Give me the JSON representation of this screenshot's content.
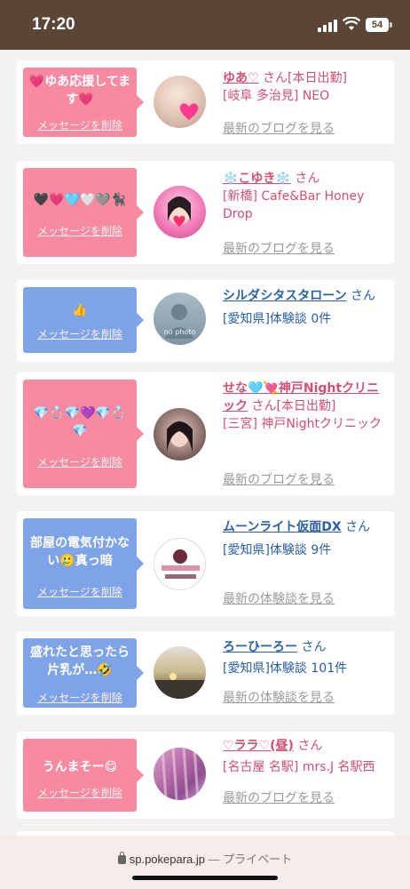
{
  "status_bar": {
    "time": "17:20",
    "battery": "54"
  },
  "cards": [
    {
      "type": "pink",
      "message": "💗ゆあ応援してます💗",
      "delete_label": "メッセージを削除",
      "name": "ゆあ♡",
      "honorific": "さん",
      "extra": "[本日出勤]",
      "detail": "[岐阜 多治見] NEO",
      "link": "最新のブログを見る"
    },
    {
      "type": "pink",
      "message": "🖤💗🩵🤍🩶🐈‍⬛",
      "delete_label": "メッセージを削除",
      "name": "❄️こゆき❄️",
      "honorific": "さん",
      "extra": "",
      "detail": "[新橋] Cafe&Bar Honey Drop",
      "link": "最新のブログを見る"
    },
    {
      "type": "blue",
      "message": "👍",
      "delete_label": "メッセージを削除",
      "name": "シルダシタスタローン",
      "honorific": "さん",
      "extra": "",
      "detail": "[愛知県]体験談 0件",
      "link": "",
      "avatar_text": "no photo"
    },
    {
      "type": "pink",
      "message": "💎💍💎💜💎💍💎",
      "delete_label": "メッセージを削除",
      "name": "せな🩵💘神戸Nightクリニック",
      "honorific": "さん",
      "extra": "[本日出勤]",
      "detail": "[三宮] 神戸Nightクリニック",
      "link": "最新のブログを見る"
    },
    {
      "type": "blue",
      "message": "部屋の電気付かない🥲真っ暗",
      "delete_label": "メッセージを削除",
      "name": "ムーンライト仮面DX",
      "honorific": "さん",
      "extra": "",
      "detail": "[愛知県]体験談 9件",
      "link": "最新の体験談を見る"
    },
    {
      "type": "blue",
      "message": "盛れたと思ったら片乳が…🤣",
      "delete_label": "メッセージを削除",
      "name": "ろーひーろー",
      "honorific": "さん",
      "extra": "",
      "detail": "[愛知県]体験談 101件",
      "link": "最新の体験談を見る"
    },
    {
      "type": "pink",
      "message": "うんまそー😋",
      "delete_label": "メッセージを削除",
      "name": "♡ララ♡(昼)",
      "honorific": "さん",
      "extra": "",
      "detail": "[名古屋 名駅] mrs.J 名駅西",
      "link": "最新のブログを見る"
    }
  ],
  "browser": {
    "url": "sp.pokepara.jp",
    "privacy": "— プライベート"
  },
  "colors": {
    "status_bar": "#5b4636",
    "pink_bubble": "#f58aa0",
    "blue_bubble": "#7ea3e6",
    "pink_text": "#d24f72",
    "blue_text": "#2b5fa7"
  }
}
